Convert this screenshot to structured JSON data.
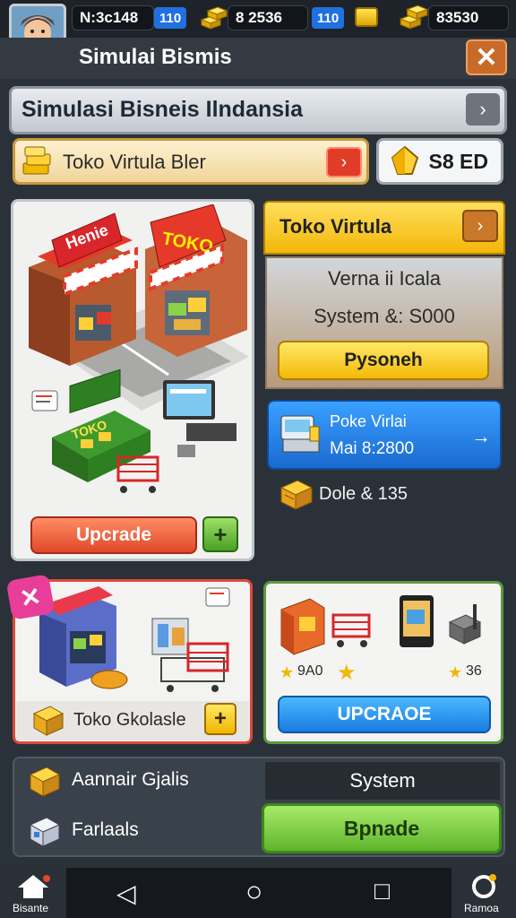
{
  "top_bar": {
    "player_name": "N:3c148",
    "level_badge": "110",
    "gold_amount": "8 2536",
    "level_badge_2": "110",
    "gold_amount_2": "83530"
  },
  "header": {
    "title": "Simulai Bismis",
    "close_label": "✕"
  },
  "subbar": {
    "title": "Simulasi Bisneis Ilndansia",
    "arrow": "›"
  },
  "store_pill": {
    "text": "Toko Virtula Bler",
    "arrow": "›"
  },
  "coin_pill": {
    "value": "S8 ED"
  },
  "main_card": {
    "sign_left": "Henie",
    "sign_right": "TOKO",
    "booth_label": "TOKO",
    "upgrade_label": "Upcrade",
    "plus_label": "+"
  },
  "info_panel": {
    "title": "Toko Virtula",
    "arrow": "›",
    "row1": "Verna ii Icala",
    "row2": "System &: S000",
    "purchase_label": "Pysoneh"
  },
  "blue_card": {
    "line1": "Poke Virlai",
    "line2": "Mai 8:2800",
    "arrow": "→"
  },
  "box_line": {
    "text": "Dole & 135"
  },
  "card_bl": {
    "tag": "✕",
    "text": "Toko Gkolasle",
    "plus_label": "+"
  },
  "card_br": {
    "num_left": "9A0",
    "num_right": "36",
    "button_label": "UPCRAOE"
  },
  "bottom_panel": {
    "line1": "Aannair Gjalis",
    "line2": "Farlaals",
    "system_label": "System",
    "green_button": "Bpnade"
  },
  "navbar": {
    "home_label": "Bisante",
    "right_label": "Ramoa",
    "back": "◁",
    "home_circle": "○",
    "recents": "□"
  },
  "colors": {
    "accent_yellow": "#f2b70a",
    "accent_red": "#e0482a",
    "accent_blue": "#1a7ce0",
    "accent_green": "#5fb52a",
    "background": "#2b3138"
  }
}
